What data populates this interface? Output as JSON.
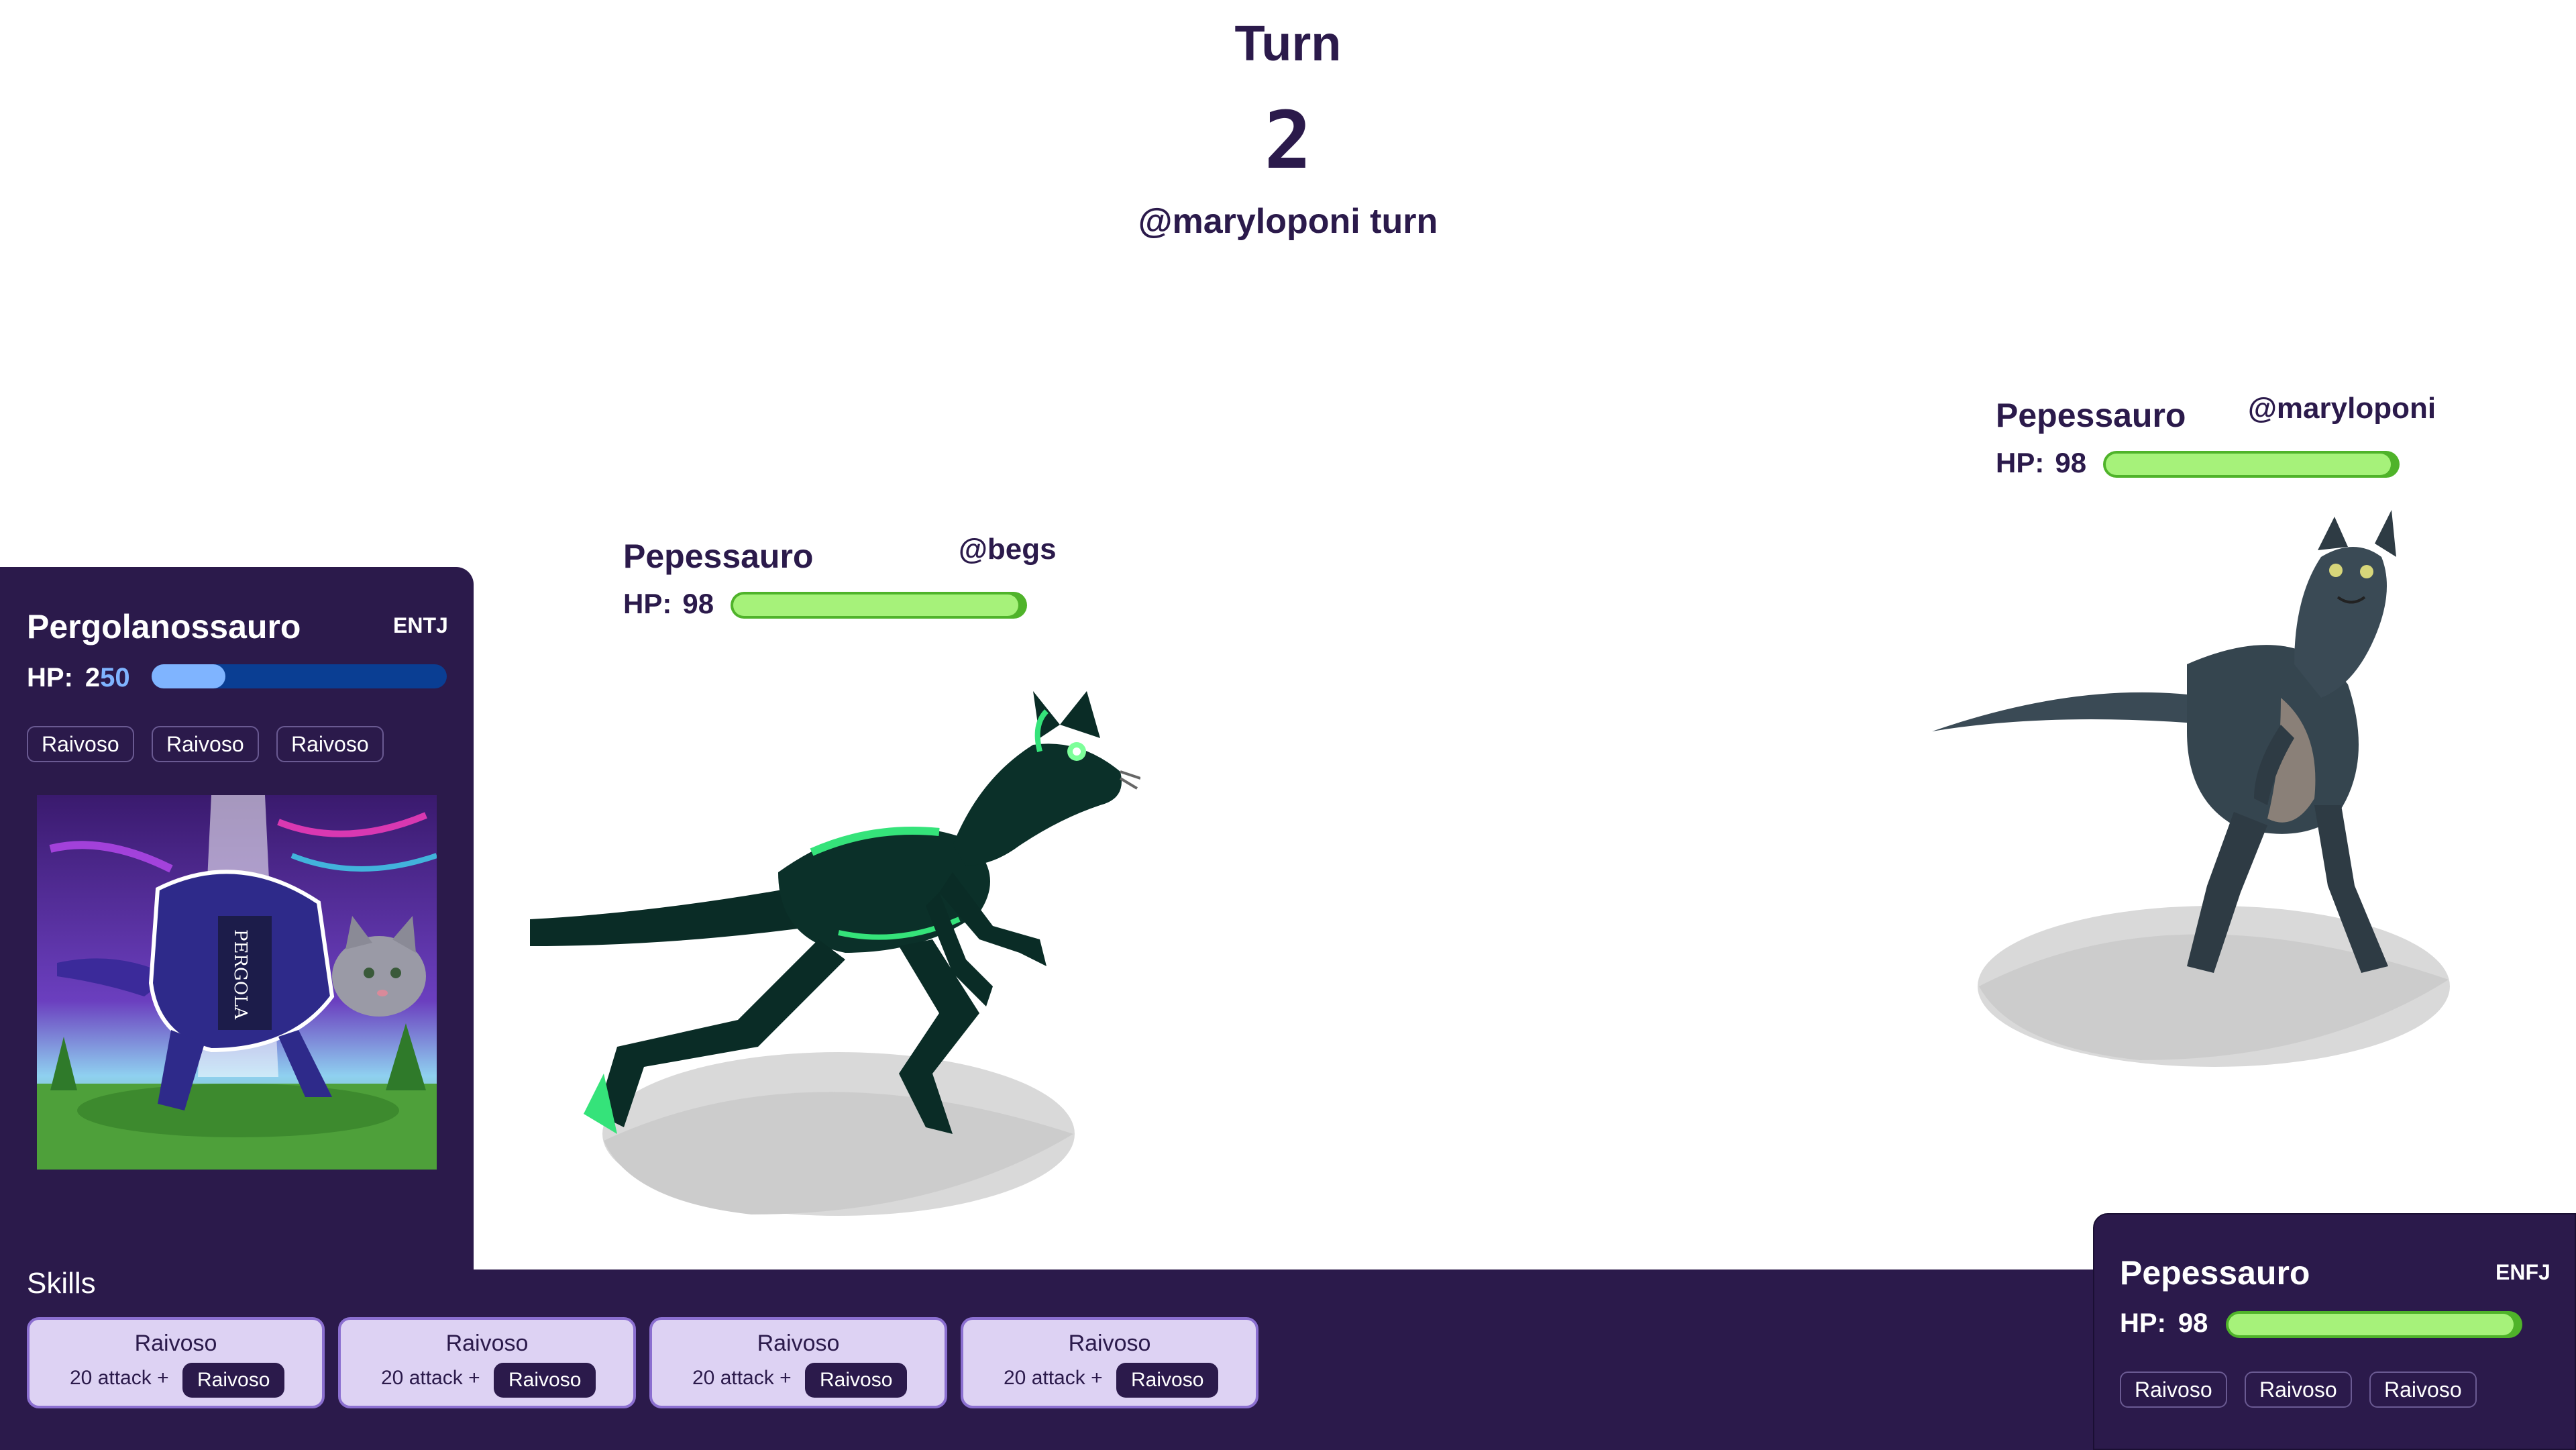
{
  "turn": {
    "title": "Turn",
    "number": "2",
    "player_turn": "@maryloponi turn"
  },
  "opponent": {
    "name": "Pepessauro",
    "owner": "@maryloponi",
    "hp_label": "HP:",
    "hp": "98",
    "hp_fraction": 0.98
  },
  "player_creature": {
    "name": "Pepessauro",
    "owner": "@begs",
    "hp_label": "HP:",
    "hp": "98",
    "hp_fraction": 0.98
  },
  "left_card": {
    "name": "Pergolanossauro",
    "type": "ENTJ",
    "hp_label": "HP:",
    "hp_part1": "2",
    "hp_part2": "50",
    "hp_fraction": 0.25,
    "tags": [
      "Raivoso",
      "Raivoso",
      "Raivoso"
    ],
    "art_text": "PERGOLA"
  },
  "skills": {
    "label": "Skills",
    "items": [
      {
        "name": "Raivoso",
        "desc": "20 attack +",
        "tag": "Raivoso"
      },
      {
        "name": "Raivoso",
        "desc": "20 attack +",
        "tag": "Raivoso"
      },
      {
        "name": "Raivoso",
        "desc": "20 attack +",
        "tag": "Raivoso"
      },
      {
        "name": "Raivoso",
        "desc": "20 attack +",
        "tag": "Raivoso"
      }
    ]
  },
  "right_card": {
    "name": "Pepessauro",
    "type": "ENFJ",
    "hp_label": "HP:",
    "hp": "98",
    "hp_fraction": 0.98,
    "tags": [
      "Raivoso",
      "Raivoso",
      "Raivoso"
    ]
  },
  "colors": {
    "panel": "#2b1a4b",
    "hp_green": "#a6f27a",
    "hp_blue": "#7fb4ff",
    "skill_bg": "#ddd2f3"
  }
}
